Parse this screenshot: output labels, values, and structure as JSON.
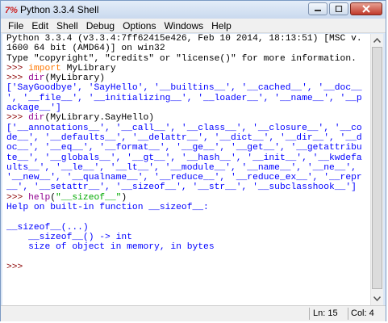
{
  "window": {
    "title": "Python 3.3.4 Shell",
    "icon": "python-icon"
  },
  "menu": [
    "File",
    "Edit",
    "Shell",
    "Debug",
    "Options",
    "Windows",
    "Help"
  ],
  "shell": {
    "banner": [
      "Python 3.3.4 (v3.3.4:7ff62415e426, Feb 10 2014, 18:13:51) [MSC v.",
      "1600 64 bit (AMD64)] on win32",
      "Type \"copyright\", \"credits\" or \"license()\" for more information."
    ],
    "prompt": ">>> ",
    "cmd1": {
      "keyword": "import",
      "rest": " MyLibrary"
    },
    "cmd2": {
      "fn": "dir",
      "rest": "(MyLibrary)"
    },
    "out2": [
      "['SayGoodbye', 'SayHello', '__builtins__', '__cached__', '__doc__",
      "', '__file__', '__initializing__', '__loader__', '__name__', '__p",
      "ackage__']"
    ],
    "cmd3": {
      "fn": "dir",
      "rest": "(MyLibrary.SayHello)"
    },
    "out3": [
      "['__annotations__', '__call__', '__class__', '__closure__', '__co",
      "de__', '__defaults__', '__delattr__', '__dict__', '__dir__', '__d",
      "oc__', '__eq__', '__format__', '__ge__', '__get__', '__getattribu",
      "te__', '__globals__', '__gt__', '__hash__', '__init__', '__kwdefa",
      "ults__', '__le__', '__lt__', '__module__', '__name__', '__ne__',",
      "'__new__', '__qualname__', '__reduce__', '__reduce_ex__', '__repr",
      "__', '__setattr__', '__sizeof__', '__str__', '__subclasshook__']"
    ],
    "cmd4": {
      "fn": "help",
      "open": "(",
      "string": "\"__sizeof__\"",
      "close": ")"
    },
    "out4": [
      "Help on built-in function __sizeof__:",
      "",
      "__sizeof__(...)",
      "    __sizeof__() -> int",
      "    size of object in memory, in bytes",
      ""
    ],
    "final_prompt": ">>>"
  },
  "status": {
    "line": "Ln: 15",
    "col": "Col: 4"
  },
  "colors": {
    "prompt": "#8b0000",
    "keyword": "#ff7700",
    "builtin": "#900090",
    "string": "#00aa00",
    "output": "#0000ff"
  }
}
